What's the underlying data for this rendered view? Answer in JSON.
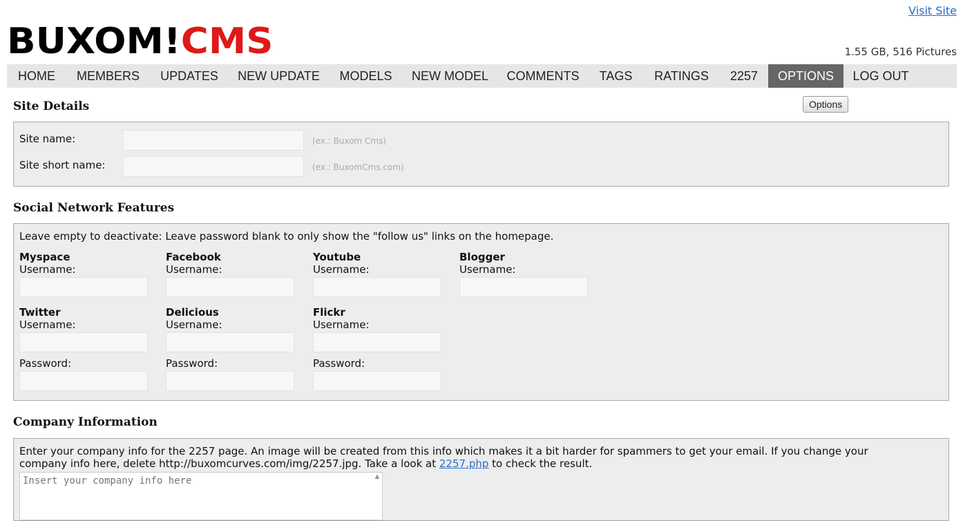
{
  "header": {
    "visit_site": "Visit Site",
    "logo_black": "BUXOM!",
    "logo_red": "CMS",
    "stats": "1.55 GB, 516 Pictures"
  },
  "nav": [
    "HOME",
    "MEMBERS",
    "UPDATES",
    "NEW UPDATE",
    "MODELS",
    "NEW MODEL",
    "COMMENTS",
    "TAGS",
    "RATINGS",
    "2257",
    "OPTIONS",
    "LOG OUT"
  ],
  "nav_active": "OPTIONS",
  "options_button": "Options",
  "site_details": {
    "title": "Site Details",
    "site_name_label": "Site name:",
    "site_name_hint": "(ex.: Buxom Cms)",
    "site_short_label": "Site short name:",
    "site_short_hint": "(ex.: BuxomCms.com)"
  },
  "social": {
    "title": "Social Network Features",
    "note": "Leave empty to deactivate: Leave password blank to only show the \"follow us\" links on the homepage.",
    "username_label": "Username:",
    "password_label": "Password:",
    "networks": [
      "Myspace",
      "Facebook",
      "Youtube",
      "Blogger",
      "Twitter",
      "Delicious",
      "Flickr"
    ]
  },
  "company": {
    "title": "Company Information",
    "note_part1": "Enter your company info for the 2257 page. An image will be created from this info which makes it a bit harder for spammers to get your email. If you change your company info here, delete http://buxomcurves.com/img/2257.jpg. Take a look at ",
    "link": "2257.php",
    "note_part2": " to check the result.",
    "placeholder": "Insert your company info here"
  }
}
